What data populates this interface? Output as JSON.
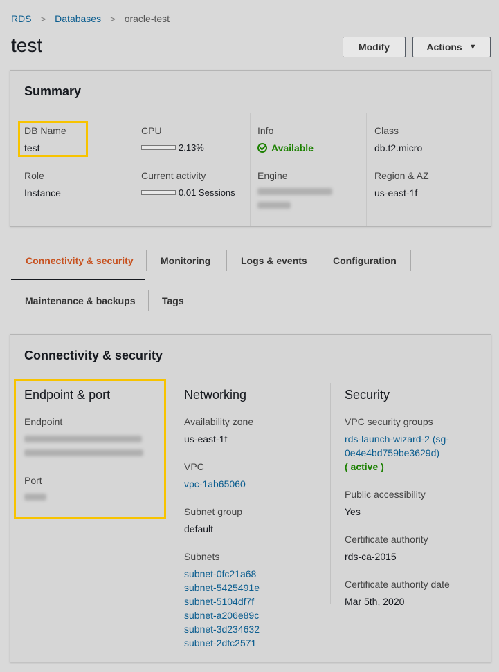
{
  "breadcrumb": {
    "root": "RDS",
    "parent": "Databases",
    "current": "oracle-test"
  },
  "page": {
    "title": "test"
  },
  "buttons": {
    "modify": "Modify",
    "actions": "Actions"
  },
  "summary": {
    "title": "Summary",
    "db_name_label": "DB Name",
    "db_name": "test",
    "role_label": "Role",
    "role": "Instance",
    "cpu_label": "CPU",
    "cpu": "2.13%",
    "cpu_fraction": 0.0213,
    "activity_label": "Current activity",
    "activity": "0.01 Sessions",
    "info_label": "Info",
    "info": "Available",
    "engine_label": "Engine",
    "class_label": "Class",
    "class": "db.t2.micro",
    "region_label": "Region & AZ",
    "region": "us-east-1f"
  },
  "tabs": [
    "Connectivity & security",
    "Monitoring",
    "Logs & events",
    "Configuration",
    "Maintenance & backups",
    "Tags"
  ],
  "active_tab": "Connectivity & security",
  "connectivity": {
    "title": "Connectivity & security",
    "endpoint_port": {
      "heading": "Endpoint & port",
      "endpoint_label": "Endpoint",
      "port_label": "Port"
    },
    "networking": {
      "heading": "Networking",
      "az_label": "Availability zone",
      "az": "us-east-1f",
      "vpc_label": "VPC",
      "vpc": "vpc-1ab65060",
      "subnet_group_label": "Subnet group",
      "subnet_group": "default",
      "subnets_label": "Subnets",
      "subnets": [
        "subnet-0fc21a68",
        "subnet-5425491e",
        "subnet-5104df7f",
        "subnet-a206e89c",
        "subnet-3d234632",
        "subnet-2dfc2571"
      ]
    },
    "security": {
      "heading": "Security",
      "sg_label": "VPC security groups",
      "sg_line1": "rds-launch-wizard-2 (sg-",
      "sg_line2": "0e4e4bd759be3629d)",
      "sg_status": "( active )",
      "public_label": "Public accessibility",
      "public": "Yes",
      "ca_label": "Certificate authority",
      "ca": "rds-ca-2015",
      "ca_date_label": "Certificate authority date",
      "ca_date": "Mar 5th, 2020"
    }
  },
  "colors": {
    "accent": "#c7511f",
    "link": "#0b5d8f",
    "success": "#1d8102",
    "highlight": "#f7c300"
  }
}
